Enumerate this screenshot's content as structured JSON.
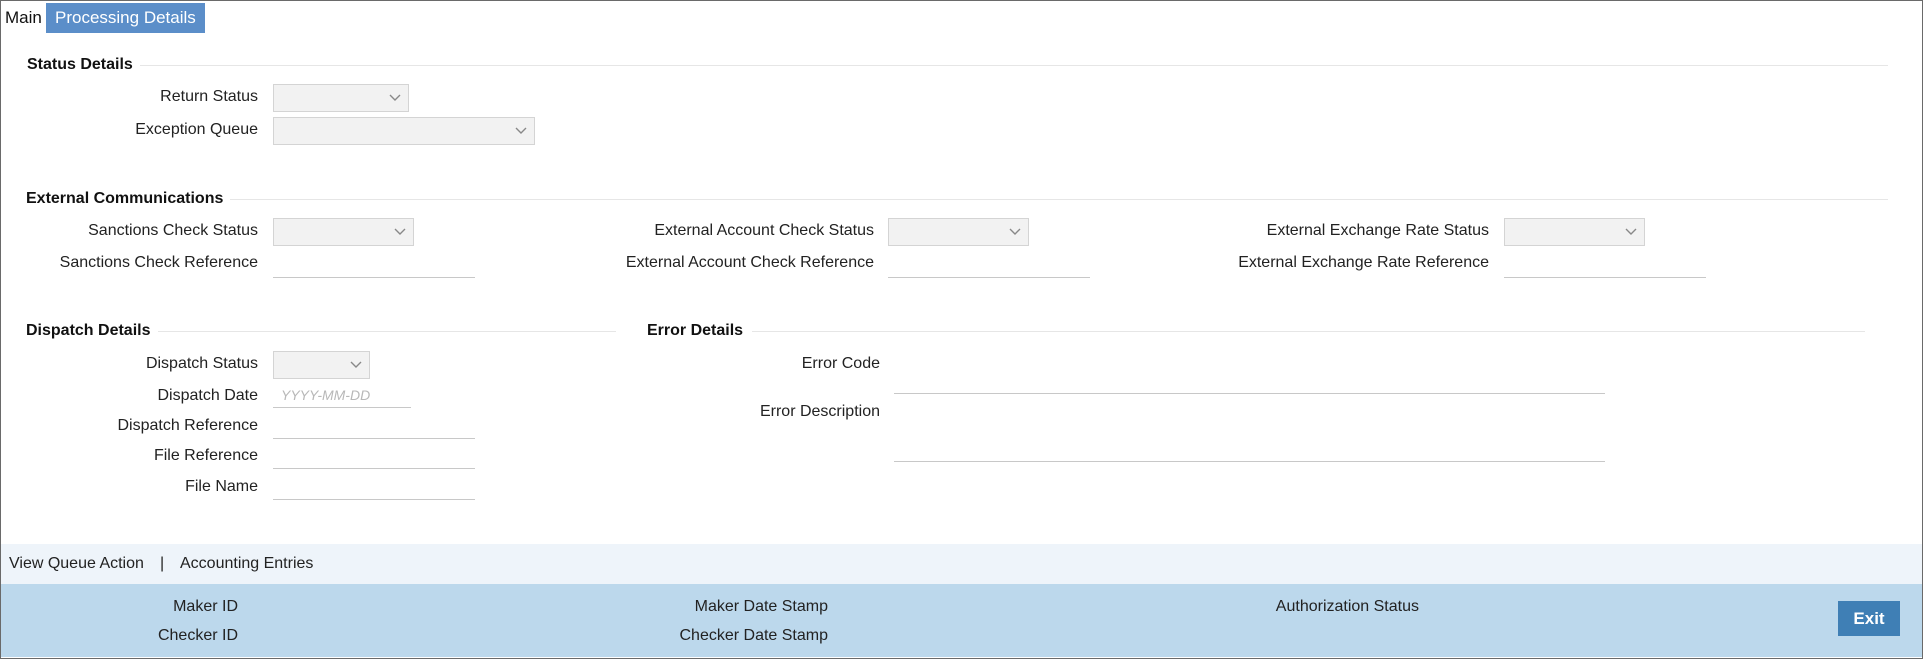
{
  "tabs": {
    "main": "Main",
    "processing_details": "Processing Details"
  },
  "status_details": {
    "title": "Status Details",
    "return_status": "Return Status",
    "exception_queue": "Exception Queue"
  },
  "external_communications": {
    "title": "External Communications",
    "sanctions_check_status": "Sanctions Check Status",
    "sanctions_check_reference": "Sanctions Check Reference",
    "external_account_check_status": "External Account Check Status",
    "external_account_check_reference": "External Account Check Reference",
    "external_exchange_rate_status": "External Exchange Rate Status",
    "external_exchange_rate_reference": "External Exchange Rate Reference"
  },
  "dispatch_details": {
    "title": "Dispatch Details",
    "dispatch_status": "Dispatch Status",
    "dispatch_date": "Dispatch Date",
    "dispatch_date_placeholder": "YYYY-MM-DD",
    "dispatch_reference": "Dispatch Reference",
    "file_reference": "File Reference",
    "file_name": "File Name"
  },
  "error_details": {
    "title": "Error Details",
    "error_code": "Error Code",
    "error_description": "Error Description"
  },
  "actions": {
    "view_queue_action": "View Queue Action",
    "separator": "|",
    "accounting_entries": "Accounting Entries"
  },
  "footer": {
    "maker_id": "Maker ID",
    "checker_id": "Checker ID",
    "maker_date_stamp": "Maker Date Stamp",
    "checker_date_stamp": "Checker Date Stamp",
    "authorization_status": "Authorization Status",
    "exit": "Exit"
  },
  "colors": {
    "tab_active": "#5b8ec9",
    "footer_bg": "#bcd8ec",
    "exit_button": "#3f7fb5"
  },
  "icons": {
    "dropdown": "chevron-down-icon"
  }
}
